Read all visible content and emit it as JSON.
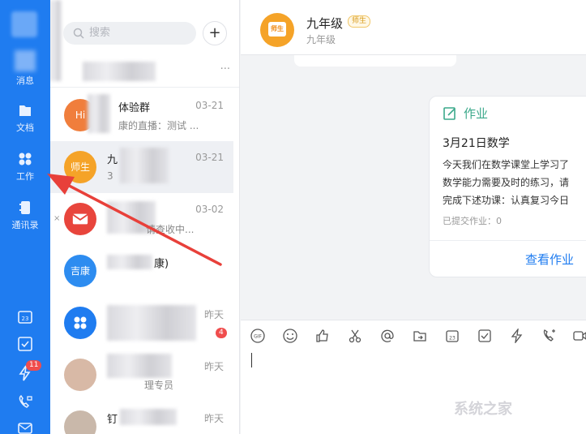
{
  "nav": {
    "items": [
      {
        "label": "消息",
        "icon": "message-icon"
      },
      {
        "label": "文档",
        "icon": "document-icon"
      },
      {
        "label": "工作",
        "icon": "work-icon"
      },
      {
        "label": "通讯录",
        "icon": "contacts-icon"
      }
    ],
    "bottom_icons": [
      "calendar-icon",
      "todo-icon",
      "flash-icon",
      "video-call-icon",
      "mail-icon"
    ],
    "badge": "11"
  },
  "search": {
    "placeholder": "搜索"
  },
  "conversations": [
    {
      "name": "体验群",
      "preview": "康的直播：测试 ...",
      "time": "03-21",
      "avatar_text": "Hi"
    },
    {
      "name": "九",
      "preview": "3",
      "time": "03-21",
      "avatar_text": "师生"
    },
    {
      "name": "",
      "preview": "请查收中...",
      "time": "03-02",
      "avatar_text": ""
    },
    {
      "name": "康)",
      "preview": "",
      "time": "",
      "avatar_text": "吉康"
    },
    {
      "name": "",
      "preview": "",
      "time": "昨天",
      "avatar_text": "",
      "badge": "4"
    },
    {
      "name": "",
      "preview": "理专员",
      "time": "昨天",
      "avatar_text": ""
    },
    {
      "name": "钉",
      "preview": "",
      "time": "昨天",
      "avatar_text": ""
    }
  ],
  "chat": {
    "title": "九年级",
    "tag": "师生",
    "subtitle": "九年级",
    "card": {
      "header": "作业",
      "subject": "3月21日数学",
      "lines": [
        "今天我们在数学课堂上学习了",
        "数学能力需要及时的练习，请",
        "完成下述功课：认真复习今日"
      ],
      "submitted": "已提交作业：0",
      "action": "查看作业"
    },
    "toolbar_icons": [
      "gif-icon",
      "emoji-icon",
      "thumbs-up-icon",
      "scissors-icon",
      "at-icon",
      "forward-icon",
      "calendar-icon",
      "todo-icon",
      "flash-icon",
      "call-icon",
      "video-icon"
    ]
  },
  "watermark": "系统之家",
  "colors": {
    "nav": "#1f7cf0",
    "accent": "#1f7cf0",
    "homework": "#3aa88a",
    "arrow": "#e8403a"
  }
}
